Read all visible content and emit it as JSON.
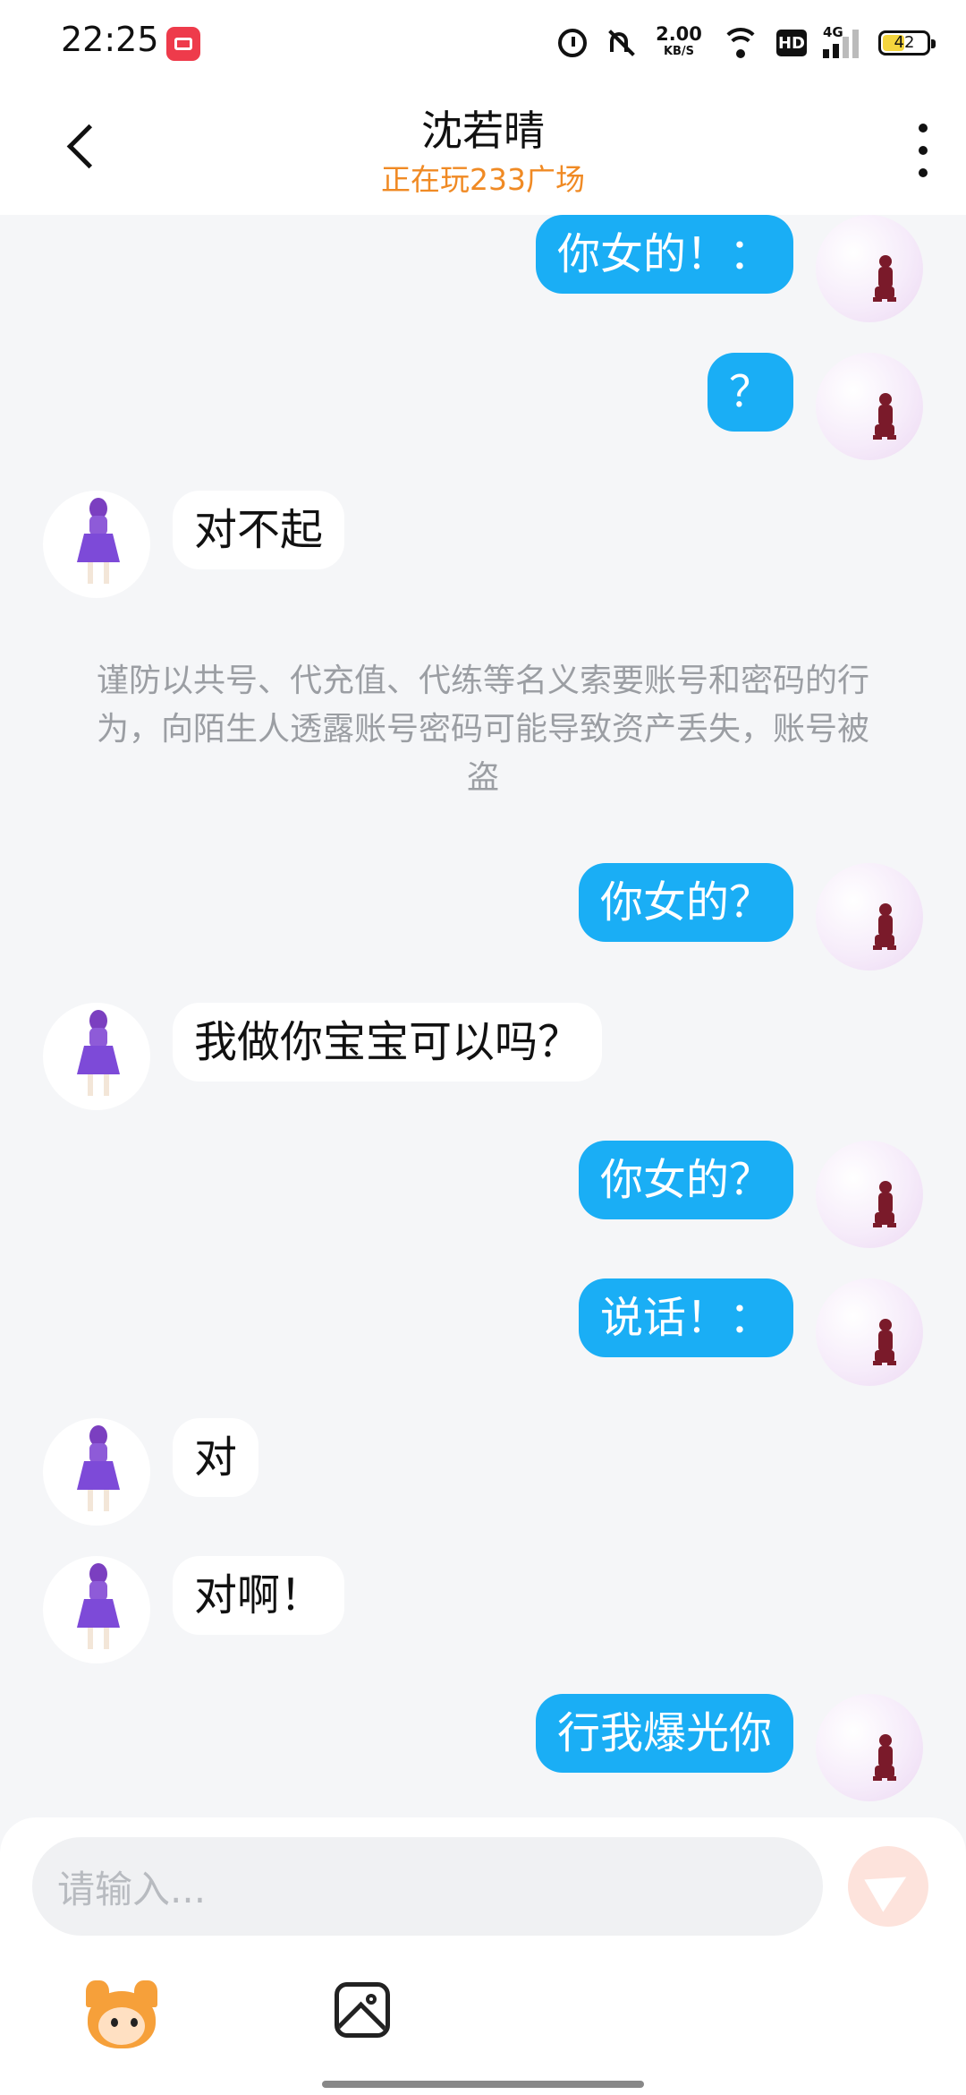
{
  "status_bar": {
    "time": "22:25",
    "net_speed": "2.00",
    "net_unit": "KB/S",
    "hd": "HD",
    "cell": "4G",
    "battery": "42",
    "icons": [
      "screen-record-icon",
      "alarm-icon",
      "mute-icon",
      "wifi-icon",
      "hd-icon",
      "cell-signal-icon",
      "battery-icon"
    ]
  },
  "header": {
    "title": "沈若晴",
    "subtitle": "正在玩233广场",
    "subtitle_color": "#f08a24"
  },
  "colors": {
    "my_bubble": "#1aaef5",
    "their_bubble": "#ffffff",
    "background": "#f5f6f8"
  },
  "messages": [
    {
      "from": "me",
      "text": "你女的！："
    },
    {
      "from": "me",
      "text": "？"
    },
    {
      "from": "other",
      "text": "对不起"
    },
    {
      "from": "me",
      "text": "你女的？"
    },
    {
      "from": "other",
      "text": "我做你宝宝可以吗？"
    },
    {
      "from": "me",
      "text": "你女的？"
    },
    {
      "from": "me",
      "text": "说话！："
    },
    {
      "from": "other",
      "text": "对"
    },
    {
      "from": "other",
      "text": "对啊！"
    },
    {
      "from": "me",
      "text": "行我爆光你"
    }
  ],
  "notice": "谨防以共号、代充值、代练等名义索要账号和密码的行为，向陌生人透露账号密码可能导致资产丢失，账号被盗",
  "input": {
    "placeholder": "请输入..."
  }
}
